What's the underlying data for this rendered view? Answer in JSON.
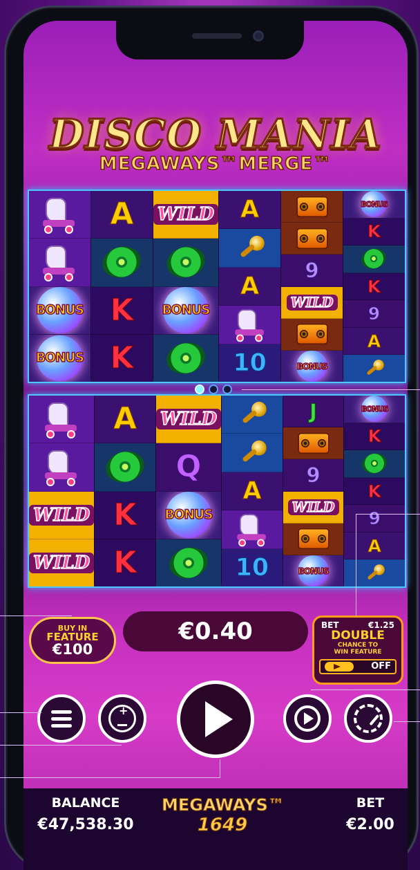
{
  "game": {
    "title": "DISCO MANIA",
    "subtitle": "MEGAWAYS™MERGE™"
  },
  "reels_top": [
    [
      {
        "s": "skate"
      },
      {
        "s": "skate"
      },
      {
        "s": "bonus"
      },
      {
        "s": "bonus"
      }
    ],
    [
      {
        "s": "A"
      },
      {
        "s": "record"
      },
      {
        "s": "K"
      },
      {
        "s": "K"
      }
    ],
    [
      {
        "s": "wild"
      },
      {
        "s": "record"
      },
      {
        "s": "bonus"
      },
      {
        "s": "record"
      }
    ],
    [
      {
        "s": "A"
      },
      {
        "s": "mic"
      },
      {
        "s": "A"
      },
      {
        "s": "skate"
      },
      {
        "s": "10"
      }
    ],
    [
      {
        "s": "boombox"
      },
      {
        "s": "boombox"
      },
      {
        "s": "9"
      },
      {
        "s": "wild"
      },
      {
        "s": "boombox"
      },
      {
        "s": "bonus"
      }
    ],
    [
      {
        "s": "bonus"
      },
      {
        "s": "K"
      },
      {
        "s": "record"
      },
      {
        "s": "K"
      },
      {
        "s": "9"
      },
      {
        "s": "A"
      },
      {
        "s": "mic"
      }
    ]
  ],
  "reels_bottom": [
    [
      {
        "s": "skate"
      },
      {
        "s": "skate"
      },
      {
        "s": "wild"
      },
      {
        "s": "wild"
      }
    ],
    [
      {
        "s": "A"
      },
      {
        "s": "record"
      },
      {
        "s": "K"
      },
      {
        "s": "K"
      }
    ],
    [
      {
        "s": "wild"
      },
      {
        "s": "Q"
      },
      {
        "s": "bonus"
      },
      {
        "s": "record"
      }
    ],
    [
      {
        "s": "mic"
      },
      {
        "s": "mic"
      },
      {
        "s": "A"
      },
      {
        "s": "skate"
      },
      {
        "s": "10"
      }
    ],
    [
      {
        "s": "J"
      },
      {
        "s": "boombox"
      },
      {
        "s": "9"
      },
      {
        "s": "wild"
      },
      {
        "s": "boombox"
      },
      {
        "s": "bonus"
      }
    ],
    [
      {
        "s": "bonus"
      },
      {
        "s": "K"
      },
      {
        "s": "record"
      },
      {
        "s": "K"
      },
      {
        "s": "9"
      },
      {
        "s": "A"
      },
      {
        "s": "mic"
      }
    ]
  ],
  "pager": {
    "count": 3,
    "active": 0
  },
  "buy_feature": {
    "line1": "BUY IN",
    "line2": "FEATURE",
    "price": "€100"
  },
  "win_amount": "€0.40",
  "double_chance": {
    "bet_label": "BET",
    "bet_value": "€1.25",
    "title": "DOUBLE",
    "line1": "CHANCE TO",
    "line2": "WIN FEATURE",
    "toggle_state": "OFF"
  },
  "footer": {
    "balance_label": "BALANCE",
    "balance_value": "€47,538.30",
    "logo_text": "MEGAWAYS™",
    "ways_count": "1649",
    "bet_label": "BET",
    "bet_value": "€2.00"
  },
  "symbol_labels": {
    "wild": "WILD",
    "bonus": "BONUS"
  },
  "colors": {
    "accent_gold": "#ffcf30",
    "frame_blue": "#4fc8ff",
    "panel_dark": "#4a0838"
  }
}
